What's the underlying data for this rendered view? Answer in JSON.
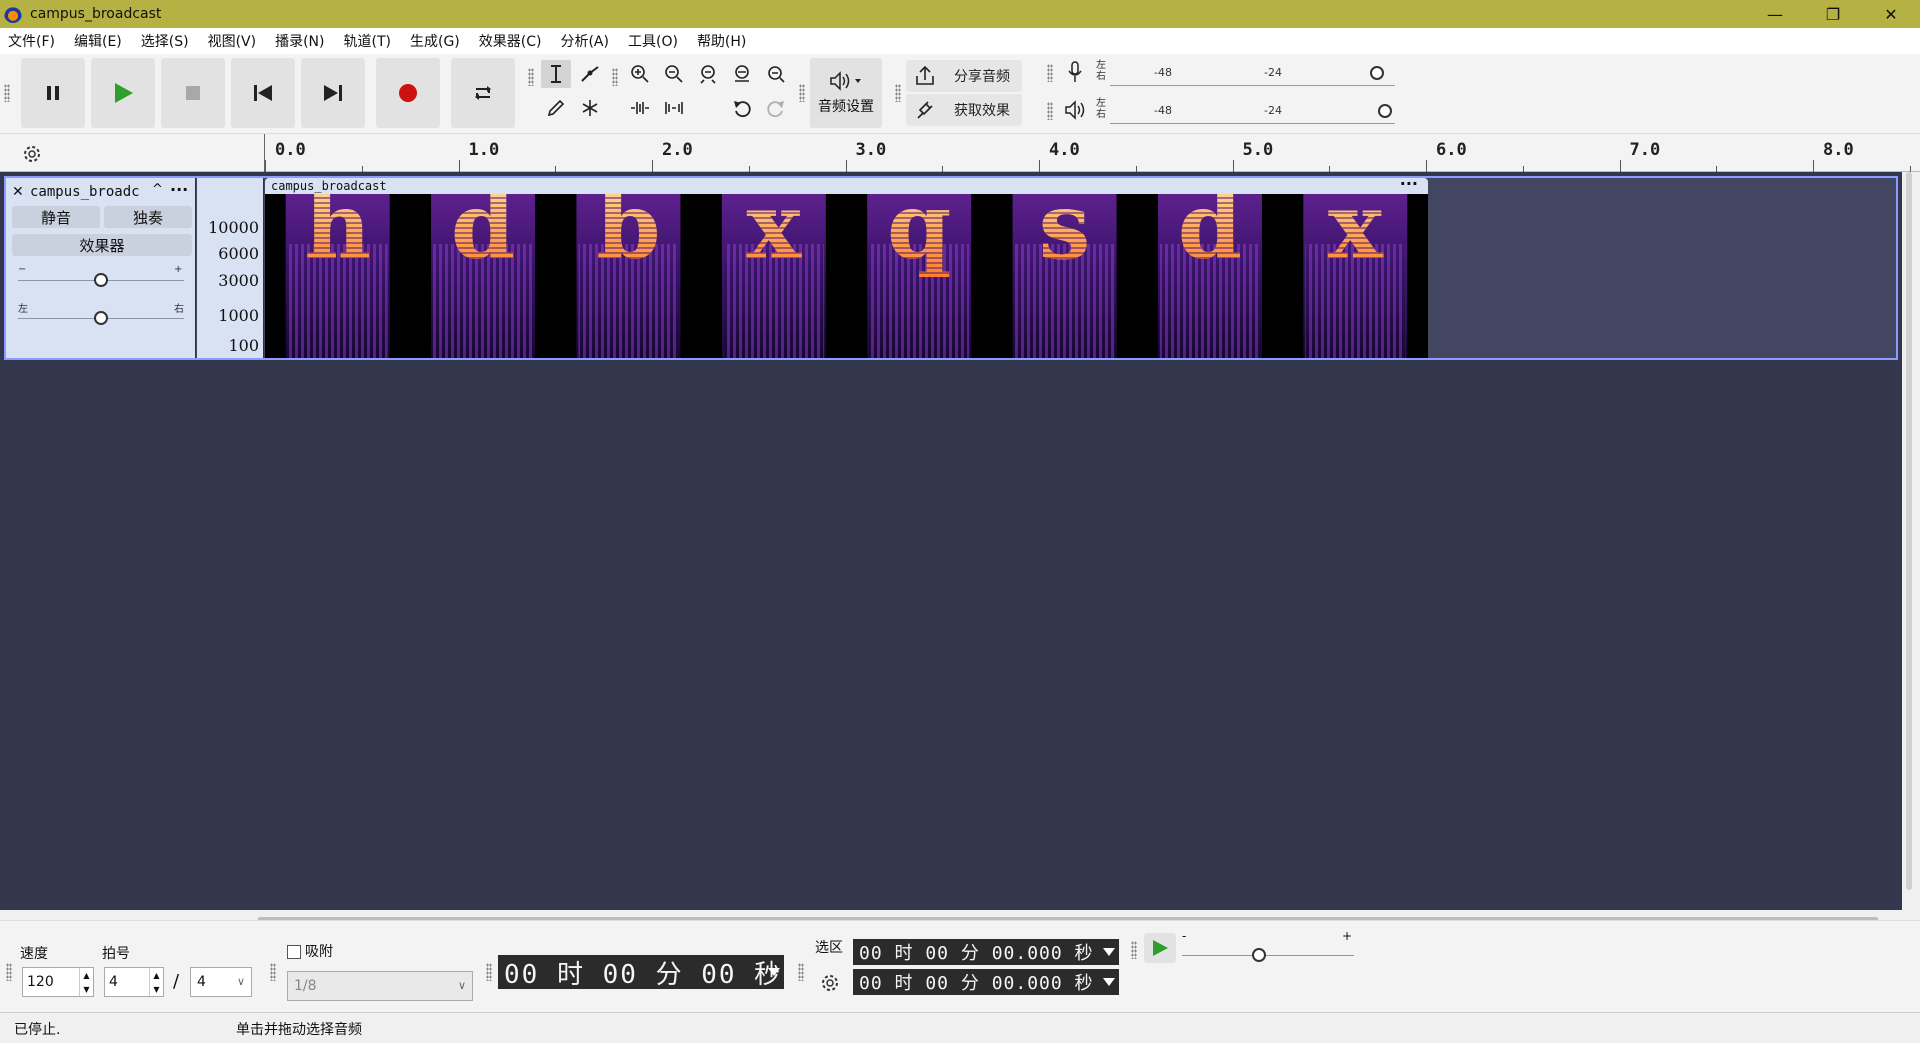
{
  "window": {
    "title": "campus_broadcast",
    "minimize": "—",
    "restore": "❐",
    "close": "✕"
  },
  "menu": [
    "文件(F)",
    "编辑(E)",
    "选择(S)",
    "视图(V)",
    "播录(N)",
    "轨道(T)",
    "生成(G)",
    "效果器(C)",
    "分析(A)",
    "工具(O)",
    "帮助(H)"
  ],
  "toolbar": {
    "audio_settings": "音频设置",
    "share_audio": "分享音频",
    "get_effects": "获取效果",
    "meter_left_right": "左\n右",
    "meter_ticks": [
      "-48",
      "-24"
    ]
  },
  "ruler": {
    "labels": [
      "0.0",
      "1.0",
      "2.0",
      "3.0",
      "4.0",
      "5.0",
      "6.0",
      "7.0",
      "8.0"
    ]
  },
  "track": {
    "name": "campus_broadc",
    "mute": "静音",
    "solo": "独奏",
    "effects": "效果器",
    "gain_minus": "−",
    "gain_plus": "+",
    "pan_left": "左",
    "pan_right": "右",
    "gain": 0.5,
    "pan": 0.5,
    "freq_labels": [
      "10000",
      "6000",
      "3000",
      "1000",
      "100"
    ],
    "clip_name": "campus_broadcast",
    "clip_menu": "···",
    "spectrogram_letters": [
      "h",
      "d",
      "b",
      "x",
      "q",
      "s",
      "d",
      "x"
    ]
  },
  "bottom": {
    "tempo_label": "速度",
    "tempo_value": "120",
    "meter_label": "拍号",
    "meter_upper": "4",
    "meter_slash": "/",
    "meter_lower": "4",
    "snap_label": "吸附",
    "snap_value": "1/8",
    "time_display": "00 时 00 分 00 秒",
    "selection_label": "选区",
    "sel_start": "00 时 00 分 00.000 秒",
    "sel_end": "00 时 00 分 00.000 秒",
    "speed_minus": "-",
    "speed_plus": "+",
    "play_speed": 0.45
  },
  "status": {
    "state": "已停止.",
    "hint": "单击并拖动选择音频"
  },
  "colors": {
    "title_bar": "#b5b142",
    "track_bg": "#33374d",
    "record_red": "#cc1111",
    "play_green": "#2e9e2e",
    "selection_border": "#8a9cff"
  }
}
